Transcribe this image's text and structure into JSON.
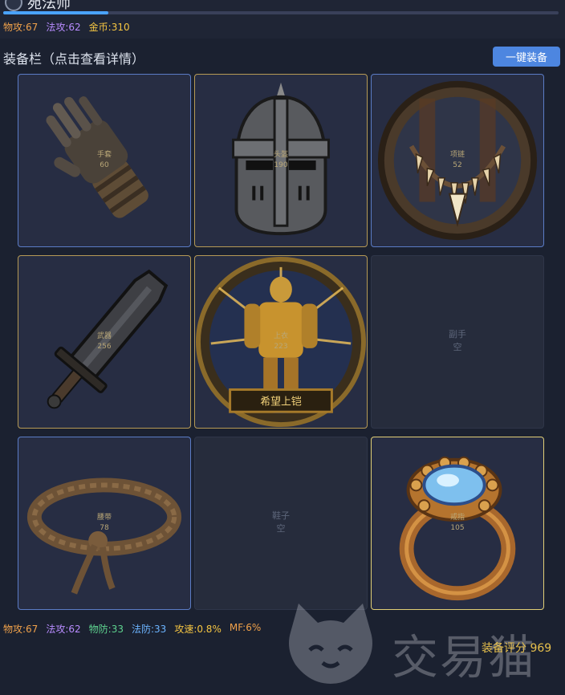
{
  "header": {
    "name": "苑法师",
    "xp_progress": 0.19,
    "stats": [
      {
        "label": "物攻:67",
        "color": "#f0a14a"
      },
      {
        "label": "法攻:62",
        "color": "#b88cff"
      },
      {
        "label": "金币:310",
        "color": "#f5c542"
      }
    ]
  },
  "equipment": {
    "title": "装备栏（点击查看详情）",
    "equip_all_label": "一键装备",
    "slots": [
      {
        "slot": "手套",
        "value": "60",
        "item_icon": "gauntlet-icon",
        "rarity": "blue"
      },
      {
        "slot": "头盔",
        "value": "190",
        "item_icon": "helmet-icon",
        "rarity": "gold"
      },
      {
        "slot": "项链",
        "value": "52",
        "item_icon": "claw-necklace-icon",
        "rarity": "blue"
      },
      {
        "slot": "武器",
        "value": "256",
        "item_icon": "sword-icon",
        "rarity": "gold"
      },
      {
        "slot": "上衣",
        "value": "223",
        "item_icon": "golden-armor-icon",
        "rarity": "gold"
      },
      {
        "slot": "副手",
        "value": "空",
        "item_icon": "",
        "rarity": "empty"
      },
      {
        "slot": "腰带",
        "value": "78",
        "item_icon": "rope-belt-icon",
        "rarity": "blue"
      },
      {
        "slot": "鞋子",
        "value": "空",
        "item_icon": "",
        "rarity": "empty"
      },
      {
        "slot": "戒指",
        "value": "105",
        "item_icon": "sapphire-ring-icon",
        "rarity": "legend"
      }
    ]
  },
  "summary": {
    "stats": [
      {
        "label": "物攻:67",
        "color": "#f0a14a"
      },
      {
        "label": "法攻:62",
        "color": "#b88cff"
      },
      {
        "label": "物防:33",
        "color": "#5ed38f"
      },
      {
        "label": "法防:33",
        "color": "#6cb4ff"
      },
      {
        "label": "攻速:0.8%",
        "color": "#f5c542"
      },
      {
        "label": "MF:6%",
        "color": "#f0a14a"
      }
    ],
    "score_label": "装备评分 969"
  },
  "watermark": {
    "text": "交易猫",
    "logo_icon": "cat-logo-icon"
  }
}
